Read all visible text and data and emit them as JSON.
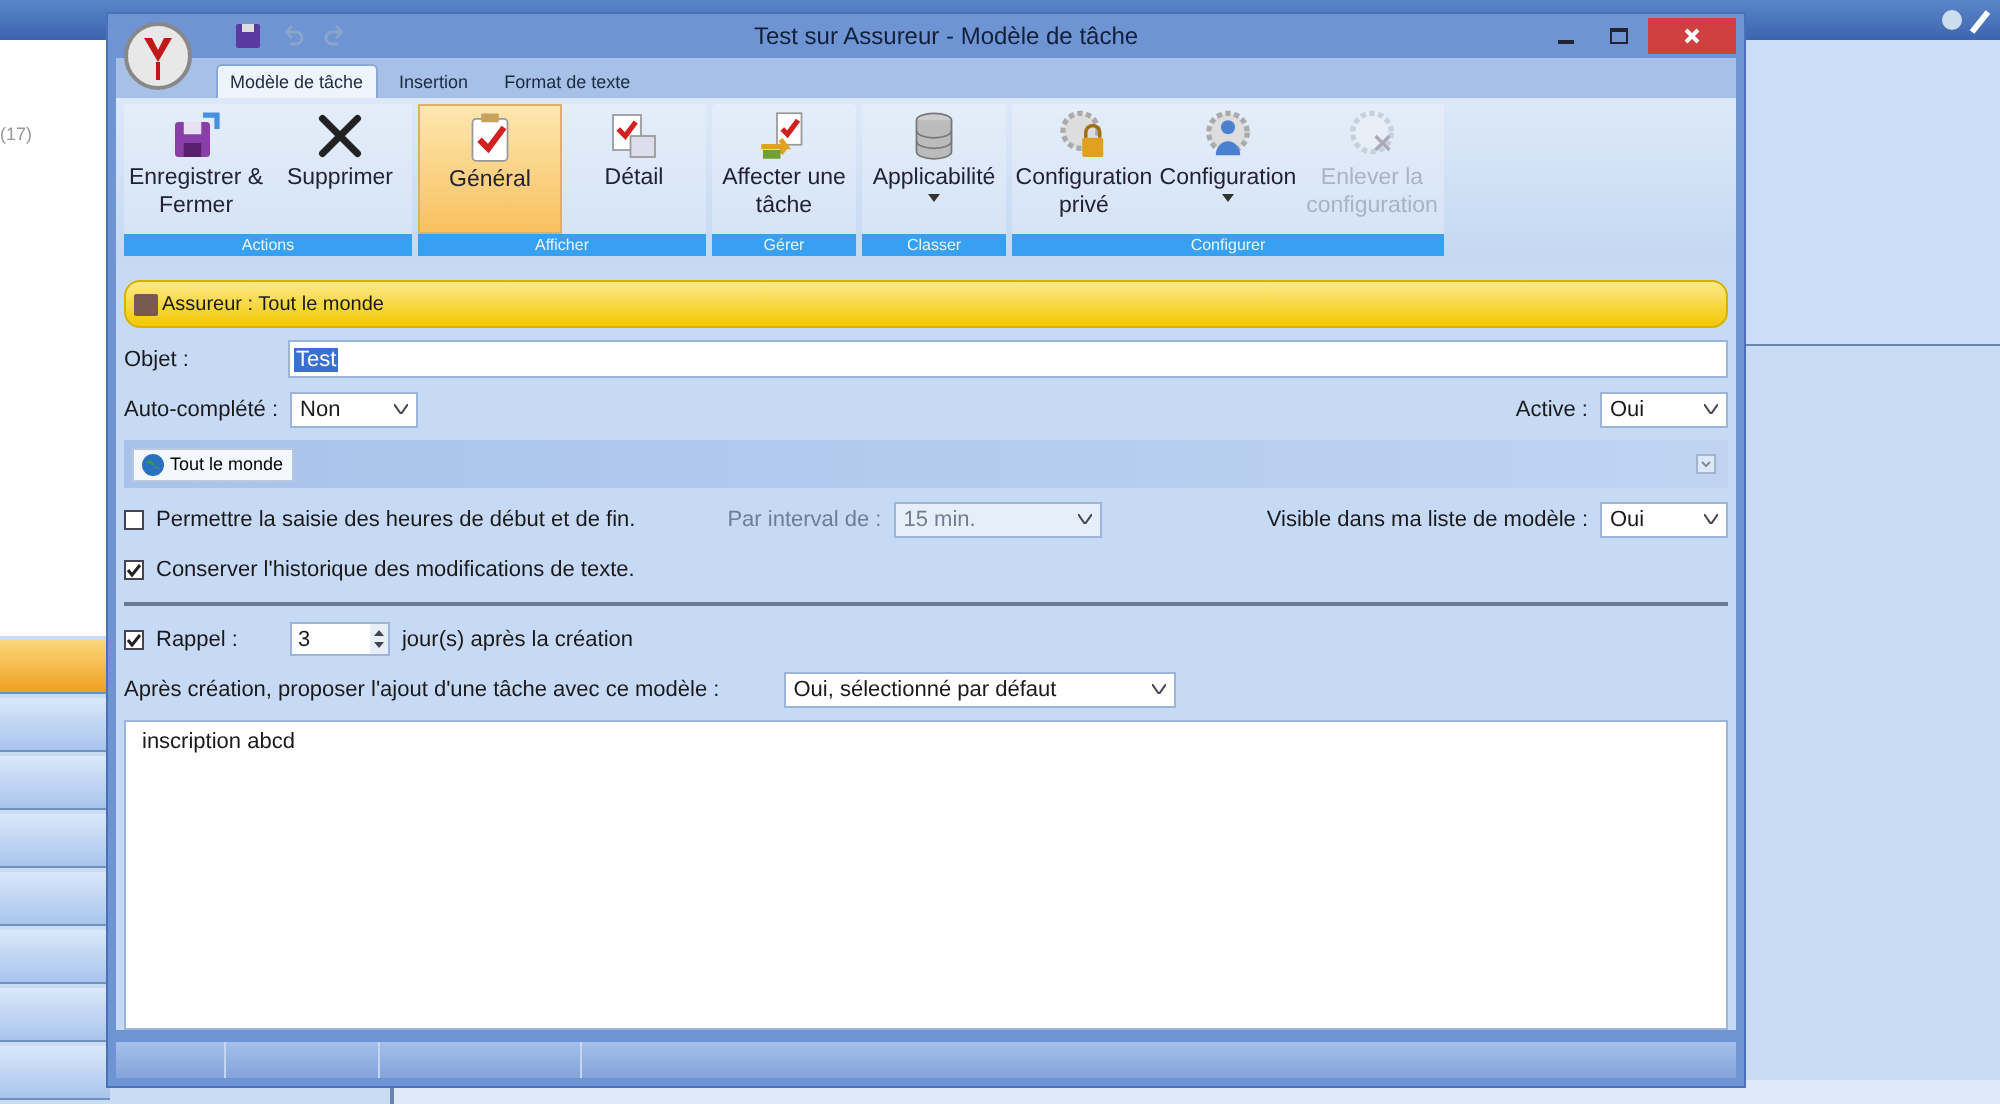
{
  "background_app": {
    "left_panel_text": "(17)",
    "list_items": [
      {
        "selected": true
      },
      {
        "selected": false
      },
      {
        "selected": false
      },
      {
        "selected": false
      },
      {
        "selected": false
      },
      {
        "selected": false
      },
      {
        "selected": false
      },
      {
        "selected": false
      }
    ]
  },
  "window": {
    "title": "Test sur Assureur - Modèle de tâche"
  },
  "tabs": [
    {
      "label": "Modèle de tâche",
      "selected": true
    },
    {
      "label": "Insertion",
      "selected": false
    },
    {
      "label": "Format de texte",
      "selected": false
    }
  ],
  "ribbon_groups": [
    {
      "label": "Actions",
      "buttons": [
        {
          "kind": "save",
          "label": "Enregistrer & Fermer",
          "selected": false,
          "disabled": false,
          "dropdown": false
        },
        {
          "kind": "delete",
          "label": "Supprimer",
          "selected": false,
          "disabled": false,
          "dropdown": false
        }
      ]
    },
    {
      "label": "Afficher",
      "buttons": [
        {
          "kind": "check",
          "label": "Général",
          "selected": true,
          "disabled": false,
          "dropdown": false
        },
        {
          "kind": "detail",
          "label": "Détail",
          "selected": false,
          "disabled": false,
          "dropdown": false
        }
      ]
    },
    {
      "label": "Gérer",
      "buttons": [
        {
          "kind": "assign",
          "label": "Affecter une tâche",
          "selected": false,
          "disabled": false,
          "dropdown": false
        }
      ]
    },
    {
      "label": "Classer",
      "buttons": [
        {
          "kind": "database",
          "label": "Applicabilité",
          "selected": false,
          "disabled": false,
          "dropdown": true
        }
      ]
    },
    {
      "label": "Configurer",
      "buttons": [
        {
          "kind": "gear-lock",
          "label": "Configuration privé",
          "selected": false,
          "disabled": false,
          "dropdown": false
        },
        {
          "kind": "gear-user",
          "label": "Configuration",
          "selected": false,
          "disabled": false,
          "dropdown": true
        },
        {
          "kind": "gear-remove",
          "label": "Enlever la configuration",
          "selected": false,
          "disabled": true,
          "dropdown": false
        }
      ]
    }
  ],
  "banner": "Assureur : Tout le monde",
  "form": {
    "objet_label": "Objet :",
    "objet_value": "Test",
    "autocomplete_label": "Auto-complété :",
    "autocomplete_value": "Non",
    "active_label": "Active :",
    "active_value": "Oui",
    "audience_button": "Tout le monde",
    "allow_hours": {
      "label": "Permettre la saisie des heures de début et de fin.",
      "checked": false
    },
    "interval_label": "Par interval de :",
    "interval_value": "15 min.",
    "interval_disabled": true,
    "visible_label": "Visible dans ma liste de modèle :",
    "visible_value": "Oui",
    "keep_history": {
      "label": "Conserver l'historique des modifications de texte.",
      "checked": true
    },
    "reminder": {
      "label": "Rappel :",
      "checked": true,
      "value": "3",
      "suffix": "jour(s) après la création"
    },
    "propose_label": "Après création, proposer l'ajout d'une tâche avec ce modèle :",
    "propose_value": "Oui, sélectionné par défaut",
    "body_text": "inscription abcd"
  }
}
